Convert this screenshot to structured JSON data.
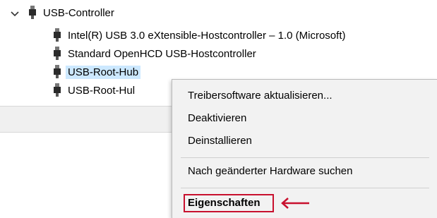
{
  "tree": {
    "category": {
      "label": "USB-Controller",
      "icon": "usb-icon",
      "expanded": true
    },
    "devices": [
      {
        "label": "Intel(R) USB 3.0 eXtensible-Hostcontroller – 1.0 (Microsoft)",
        "icon": "usb-icon"
      },
      {
        "label": "Standard OpenHCD USB-Hostcontroller",
        "icon": "usb-icon"
      },
      {
        "label": "USB-Root-Hub",
        "icon": "usb-icon",
        "selected": true
      },
      {
        "label": "USB-Root-Hul",
        "icon": "usb-icon"
      }
    ]
  },
  "context_menu": {
    "items": [
      {
        "label": "Treibersoftware aktualisieren..."
      },
      {
        "label": "Deaktivieren"
      },
      {
        "label": "Deinstallieren"
      },
      {
        "label": "Nach geänderter Hardware suchen"
      },
      {
        "label": "Eigenschaften",
        "bold": true,
        "highlighted": true
      }
    ]
  },
  "colors": {
    "selection": "#cce8ff",
    "menu_background": "#f2f2f2",
    "annotation": "#c8102e"
  }
}
